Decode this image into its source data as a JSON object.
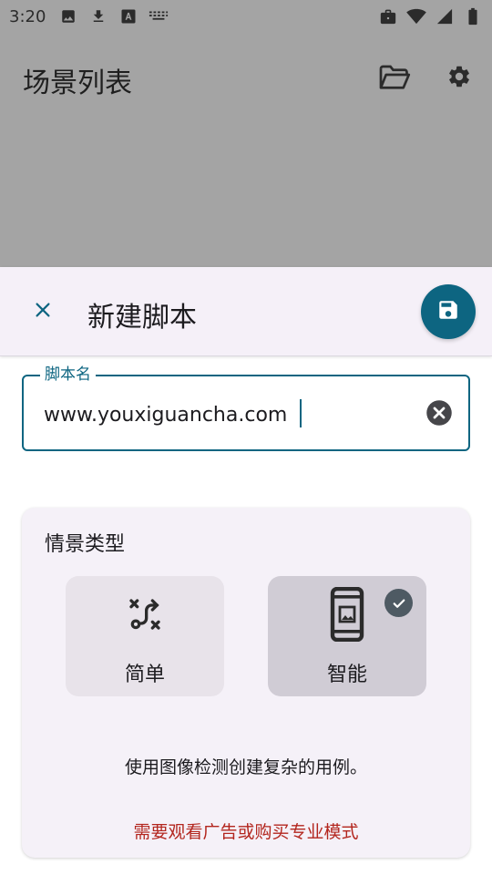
{
  "status_bar": {
    "time": "3:20",
    "left_icons": [
      "image-icon",
      "download-icon",
      "font-icon",
      "keyboard-icon"
    ],
    "right_icons": [
      "briefcase-icon",
      "wifi-icon",
      "signal-icon",
      "battery-icon"
    ]
  },
  "background_app": {
    "title": "场景列表",
    "icons": [
      "folder-icon",
      "gear-icon"
    ]
  },
  "sheet": {
    "title": "新建脚本",
    "close_icon": "close-icon",
    "save_icon": "save-icon",
    "accent_color": "#0d6581"
  },
  "script_name_field": {
    "label": "脚本名",
    "value": "www.youxiguancha.com",
    "clear_icon": "clear-icon"
  },
  "scene_type": {
    "title": "情景类型",
    "options": [
      {
        "label": "简单",
        "icon": "route-icon",
        "selected": false
      },
      {
        "label": "智能",
        "icon": "phone-image-icon",
        "selected": true
      }
    ],
    "description": "使用图像检测创建复杂的用例。",
    "notice": "需要观看广告或购买专业模式",
    "notice_color": "#b3261e"
  }
}
